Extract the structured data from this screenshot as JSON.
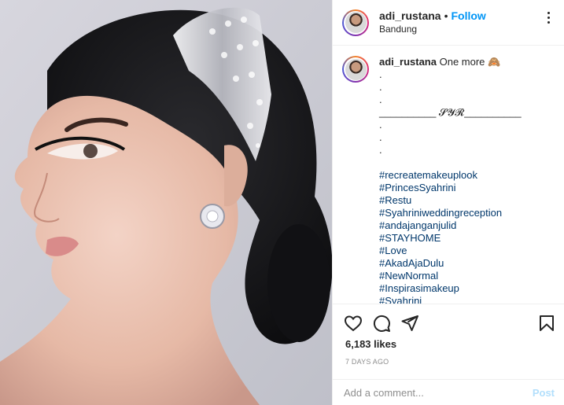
{
  "header": {
    "username": "adi_rustana",
    "separator": "•",
    "follow_label": "Follow",
    "location": "Bandung",
    "more_icon": "more-options-icon"
  },
  "caption": {
    "username": "adi_rustana",
    "text": "One more",
    "emoji": "🙈",
    "lines": [
      ".",
      ".",
      ".",
      "__________ 𝓢𝓨𝓡__________",
      ".",
      ".",
      "."
    ],
    "hashtags": [
      "#recreatemakeuplook",
      "#PrincesSyahrini",
      "#Restu",
      "#Syahriniweddingreception",
      "#andajanganjulid",
      "#STAYHOME",
      "#Love",
      "#AkadAjaDulu",
      "#NewNormal",
      "#Inspirasimakeup",
      "#Syahrini"
    ]
  },
  "actions": {
    "like_icon": "heart-icon",
    "comment_icon": "comment-icon",
    "share_icon": "share-icon",
    "save_icon": "bookmark-icon"
  },
  "likes": "6,183 likes",
  "time_ago": "7 DAYS AGO",
  "comment_box": {
    "placeholder": "Add a comment...",
    "post_label": "Post"
  },
  "colors": {
    "follow": "#0095f6",
    "hashtag": "#00376b",
    "muted": "#8e8e8e",
    "post_disabled": "#b2dffc"
  }
}
